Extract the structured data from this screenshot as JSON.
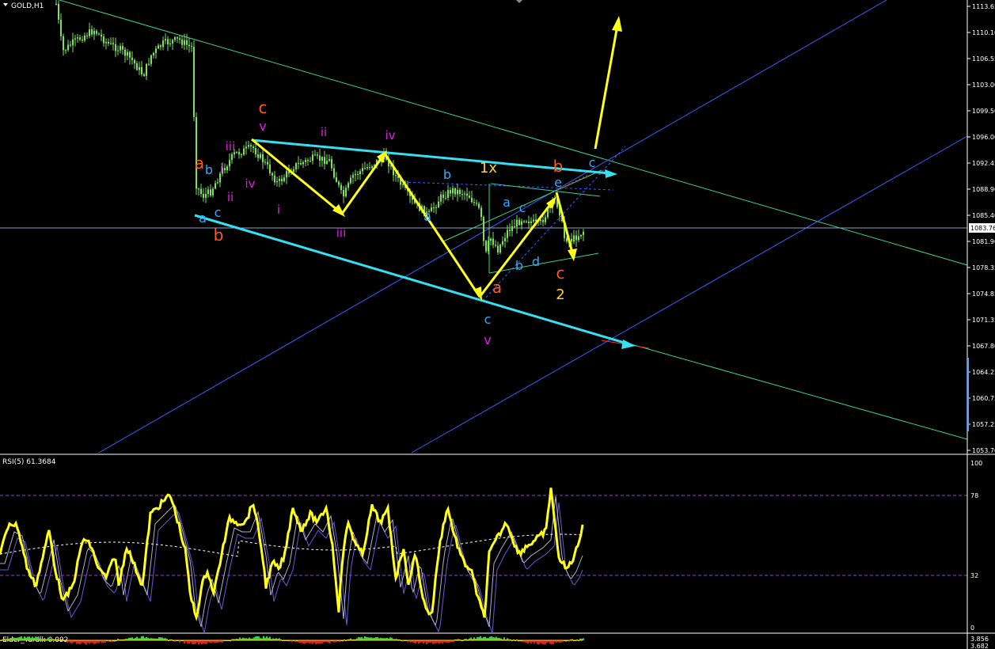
{
  "symbol_tab": {
    "label": "GOLD,H1"
  },
  "price_axis": {
    "ticks": [
      "1113.65",
      "1110.10",
      "1106.55",
      "1103.00",
      "1099.50",
      "1096.00",
      "1092.45",
      "1088.90",
      "1085.40",
      "1081.90",
      "1078.35",
      "1074.85",
      "1071.35",
      "1067.80",
      "1064.25",
      "1060.75",
      "1057.25",
      "1053.70"
    ],
    "current_label": "1083.76",
    "current_price": 1083.76
  },
  "rsi_panel": {
    "label": "RSI(5) 61.3684",
    "value": 61.3684,
    "ticks": [
      "100",
      "78",
      "32",
      "0"
    ],
    "levels": [
      78,
      32
    ]
  },
  "sub_panel": {
    "label": "Elder_Yurdik 0.092",
    "axis_top": "3.856",
    "axis_bottom": "3.682"
  },
  "colors": {
    "background": "#000000",
    "candle": "#7fe05a",
    "arrow": "#ffff1a",
    "channel": "#35e0f0",
    "trend_green": "#3cd08a",
    "pitchfork_blue": "#3f5cff",
    "rsi": "#ffff1a",
    "wave_orange": "#ff5a1a",
    "wave_magenta": "#e020e0",
    "wave_blue": "#33aaff",
    "wave_yellow": "#ffd21a"
  },
  "wave_labels": [
    {
      "text": "c",
      "color": "orange"
    },
    {
      "text": "v",
      "color": "magenta"
    },
    {
      "text": "a",
      "color": "orange"
    },
    {
      "text": "b",
      "color": "blue"
    },
    {
      "text": "i",
      "color": "magenta"
    },
    {
      "text": "iii",
      "color": "magenta"
    },
    {
      "text": "ii",
      "color": "magenta"
    },
    {
      "text": "iv",
      "color": "magenta"
    },
    {
      "text": "a",
      "color": "blue"
    },
    {
      "text": "c",
      "color": "blue"
    },
    {
      "text": "b",
      "color": "orange"
    },
    {
      "text": "i",
      "color": "magenta"
    },
    {
      "text": "ii",
      "color": "magenta"
    },
    {
      "text": "iii",
      "color": "magenta"
    },
    {
      "text": "iv",
      "color": "magenta"
    },
    {
      "text": "b",
      "color": "blue"
    },
    {
      "text": "a",
      "color": "blue"
    },
    {
      "text": "1x",
      "color": "yellow"
    },
    {
      "text": "b",
      "color": "orange"
    },
    {
      "text": "c",
      "color": "blue"
    },
    {
      "text": "e",
      "color": "blue"
    },
    {
      "text": "a",
      "color": "blue"
    },
    {
      "text": "c",
      "color": "blue"
    },
    {
      "text": "a",
      "color": "orange"
    },
    {
      "text": "b",
      "color": "blue"
    },
    {
      "text": "d",
      "color": "blue"
    },
    {
      "text": "c",
      "color": "orange"
    },
    {
      "text": "2",
      "color": "yellow"
    },
    {
      "text": "c",
      "color": "blue"
    },
    {
      "text": "v",
      "color": "magenta"
    }
  ]
}
